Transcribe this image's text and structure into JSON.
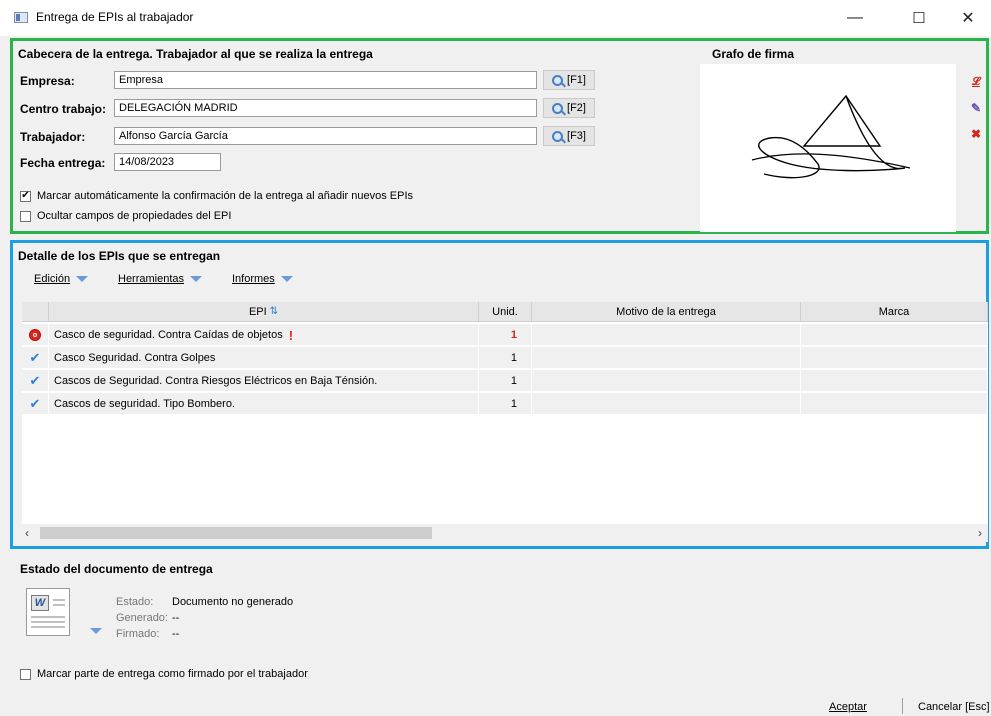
{
  "window": {
    "title": "Entrega de EPIs al trabajador",
    "minimize": "—",
    "maximize": "☐",
    "close": "✕"
  },
  "header": {
    "title": "Cabecera de la entrega. Trabajador al que se realiza la entrega",
    "empresa": {
      "label": "Empresa:",
      "value": "Empresa",
      "button": "[F1]"
    },
    "centro": {
      "label": "Centro trabajo:",
      "value": "DELEGACIÓN MADRID",
      "button": "[F2]"
    },
    "trabajador": {
      "label": "Trabajador:",
      "value": "Alfonso García García",
      "button": "[F3]"
    },
    "fecha": {
      "label": "Fecha entrega:",
      "value": "14/08/2023"
    },
    "check_auto": {
      "label": "Marcar automáticamente la confirmación de la entrega al añadir nuevos EPIs",
      "checked": true
    },
    "check_ocultar": {
      "label": "Ocultar campos de propiedades del EPI",
      "checked": false
    }
  },
  "signature": {
    "title": "Grafo de firma"
  },
  "detail": {
    "title": "Detalle de los EPIs que se entregan",
    "menu": [
      {
        "label": "Edición"
      },
      {
        "label": "Herramientas"
      },
      {
        "label": "Informes"
      }
    ],
    "columns": {
      "epi": "EPI",
      "unid": "Unid.",
      "motivo": "Motivo de la entrega",
      "marca": "Marca"
    },
    "rows": [
      {
        "epi": "Casco de seguridad. Contra Caídas de objetos",
        "unid": "1",
        "status": "alert",
        "flag": "!"
      },
      {
        "epi": "Casco Seguridad. Contra Golpes",
        "unid": "1",
        "status": "ok"
      },
      {
        "epi": "Cascos de Seguridad. Contra Riesgos Eléctricos en Baja Ténsión.",
        "unid": "1",
        "status": "ok"
      },
      {
        "epi": "Cascos de seguridad. Tipo Bombero.",
        "unid": "1",
        "status": "ok"
      }
    ]
  },
  "document": {
    "title": "Estado del documento de entrega",
    "estado_label": "Estado:",
    "estado_value": "Documento no generado",
    "generado_label": "Generado:",
    "generado_value": "--",
    "firmado_label": "Firmado:",
    "firmado_value": "--",
    "check_firmado": {
      "label": "Marcar parte de entrega como firmado por el trabajador",
      "checked": false
    }
  },
  "footer": {
    "accept": "Aceptar",
    "cancel": "Cancelar [Esc]"
  },
  "colors": {
    "green_frame": "#2ab34b",
    "blue_frame": "#1a9fe0",
    "alert_red": "#e2231a",
    "check_blue": "#2d7fd3"
  }
}
